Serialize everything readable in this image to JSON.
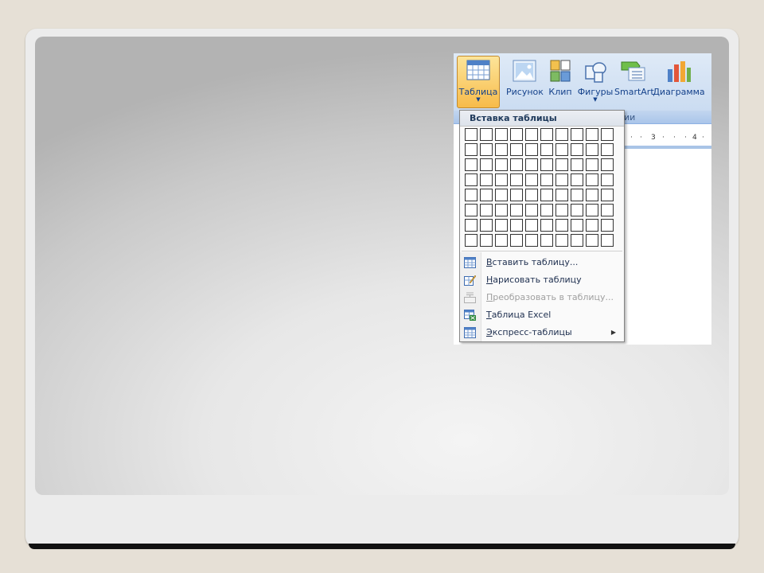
{
  "ribbon": {
    "buttons": [
      {
        "id": "table",
        "label": "Таблица",
        "has_arrow": true,
        "icon": "table-icon"
      },
      {
        "id": "picture",
        "label": "Рисунок",
        "icon": "picture-icon"
      },
      {
        "id": "clip",
        "label": "Клип",
        "icon": "clipart-icon"
      },
      {
        "id": "shapes",
        "label": "Фигуры",
        "has_arrow": true,
        "icon": "shapes-icon"
      },
      {
        "id": "smartart",
        "label": "SmartArt",
        "icon": "smartart-icon"
      },
      {
        "id": "chart",
        "label": "Диаграмма",
        "icon": "chart-icon"
      }
    ],
    "group_label_fragment": "ии"
  },
  "ruler": {
    "marks": [
      "3",
      "4"
    ]
  },
  "dropdown": {
    "title": "Вставка таблицы",
    "grid": {
      "columns": 10,
      "rows": 8
    },
    "items": [
      {
        "label": "Вставить таблицу...",
        "mnemonic": "В",
        "rest": "ставить таблицу...",
        "icon": "insert-table-icon",
        "disabled": false
      },
      {
        "label": "Нарисовать таблицу",
        "mnemonic": "Н",
        "rest": "арисовать таблицу",
        "icon": "draw-table-icon",
        "disabled": false
      },
      {
        "label": "Преобразовать в таблицу...",
        "mnemonic": "П",
        "rest": "реобразовать в таблицу...",
        "icon": "convert-table-icon",
        "disabled": true
      },
      {
        "label": "Таблица Excel",
        "mnemonic": "Т",
        "rest": "аблица Excel",
        "icon": "excel-table-icon",
        "disabled": false
      },
      {
        "label": "Экспресс-таблицы",
        "mnemonic": "Э",
        "rest": "кспресс-таблицы",
        "icon": "quick-tables-icon",
        "disabled": false,
        "submenu": true
      }
    ]
  },
  "colors": {
    "ribbon_text": "#15428b",
    "highlight": "#f7bb4a",
    "frame": "#ececec",
    "background": "#e6e0d6"
  }
}
